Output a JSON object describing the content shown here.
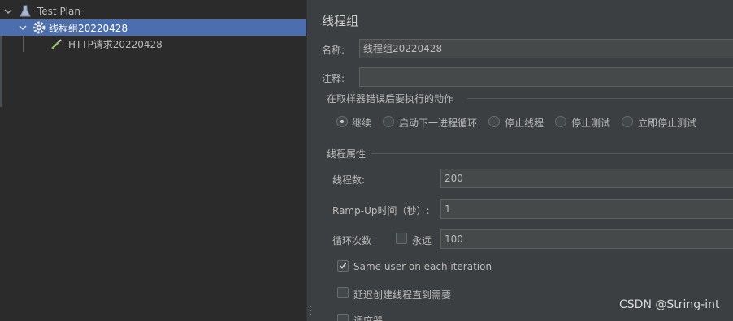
{
  "tree": {
    "items": [
      {
        "label": "Test Plan",
        "icon": "test-plan-icon"
      },
      {
        "label": "线程组20220428",
        "icon": "gear-icon"
      },
      {
        "label": "HTTP请求20220428",
        "icon": "pipette-icon"
      }
    ]
  },
  "panel": {
    "title": "线程组",
    "name_label": "名称:",
    "name_value": "线程组20220428",
    "comment_label": "注释:",
    "comment_value": "",
    "error_action_group": "在取样器错误后要执行的动作",
    "error_actions": [
      {
        "label": "继续",
        "selected": true
      },
      {
        "label": "启动下一进程循环",
        "selected": false
      },
      {
        "label": "停止线程",
        "selected": false
      },
      {
        "label": "停止测试",
        "selected": false
      },
      {
        "label": "立即停止测试",
        "selected": false
      }
    ],
    "thread_props_group": "线程属性",
    "threads_label": "线程数:",
    "threads_value": "200",
    "rampup_label": "Ramp-Up时间（秒）:",
    "rampup_value": "1",
    "loop_label": "循环次数",
    "forever_label": "永远",
    "forever_checked": false,
    "loop_value": "100",
    "same_user_label": "Same user on each iteration",
    "same_user_checked": true,
    "delay_label": "延迟创建线程直到需要",
    "delay_checked": false,
    "scheduler_label": "调度器",
    "scheduler_checked": false
  },
  "watermark": "CSDN @String-int",
  "colors": {
    "selection": "#4b6eaf",
    "tree_bg": "#2b2b2b",
    "panel_bg": "#3c3f41",
    "field_bg": "#45494a"
  }
}
